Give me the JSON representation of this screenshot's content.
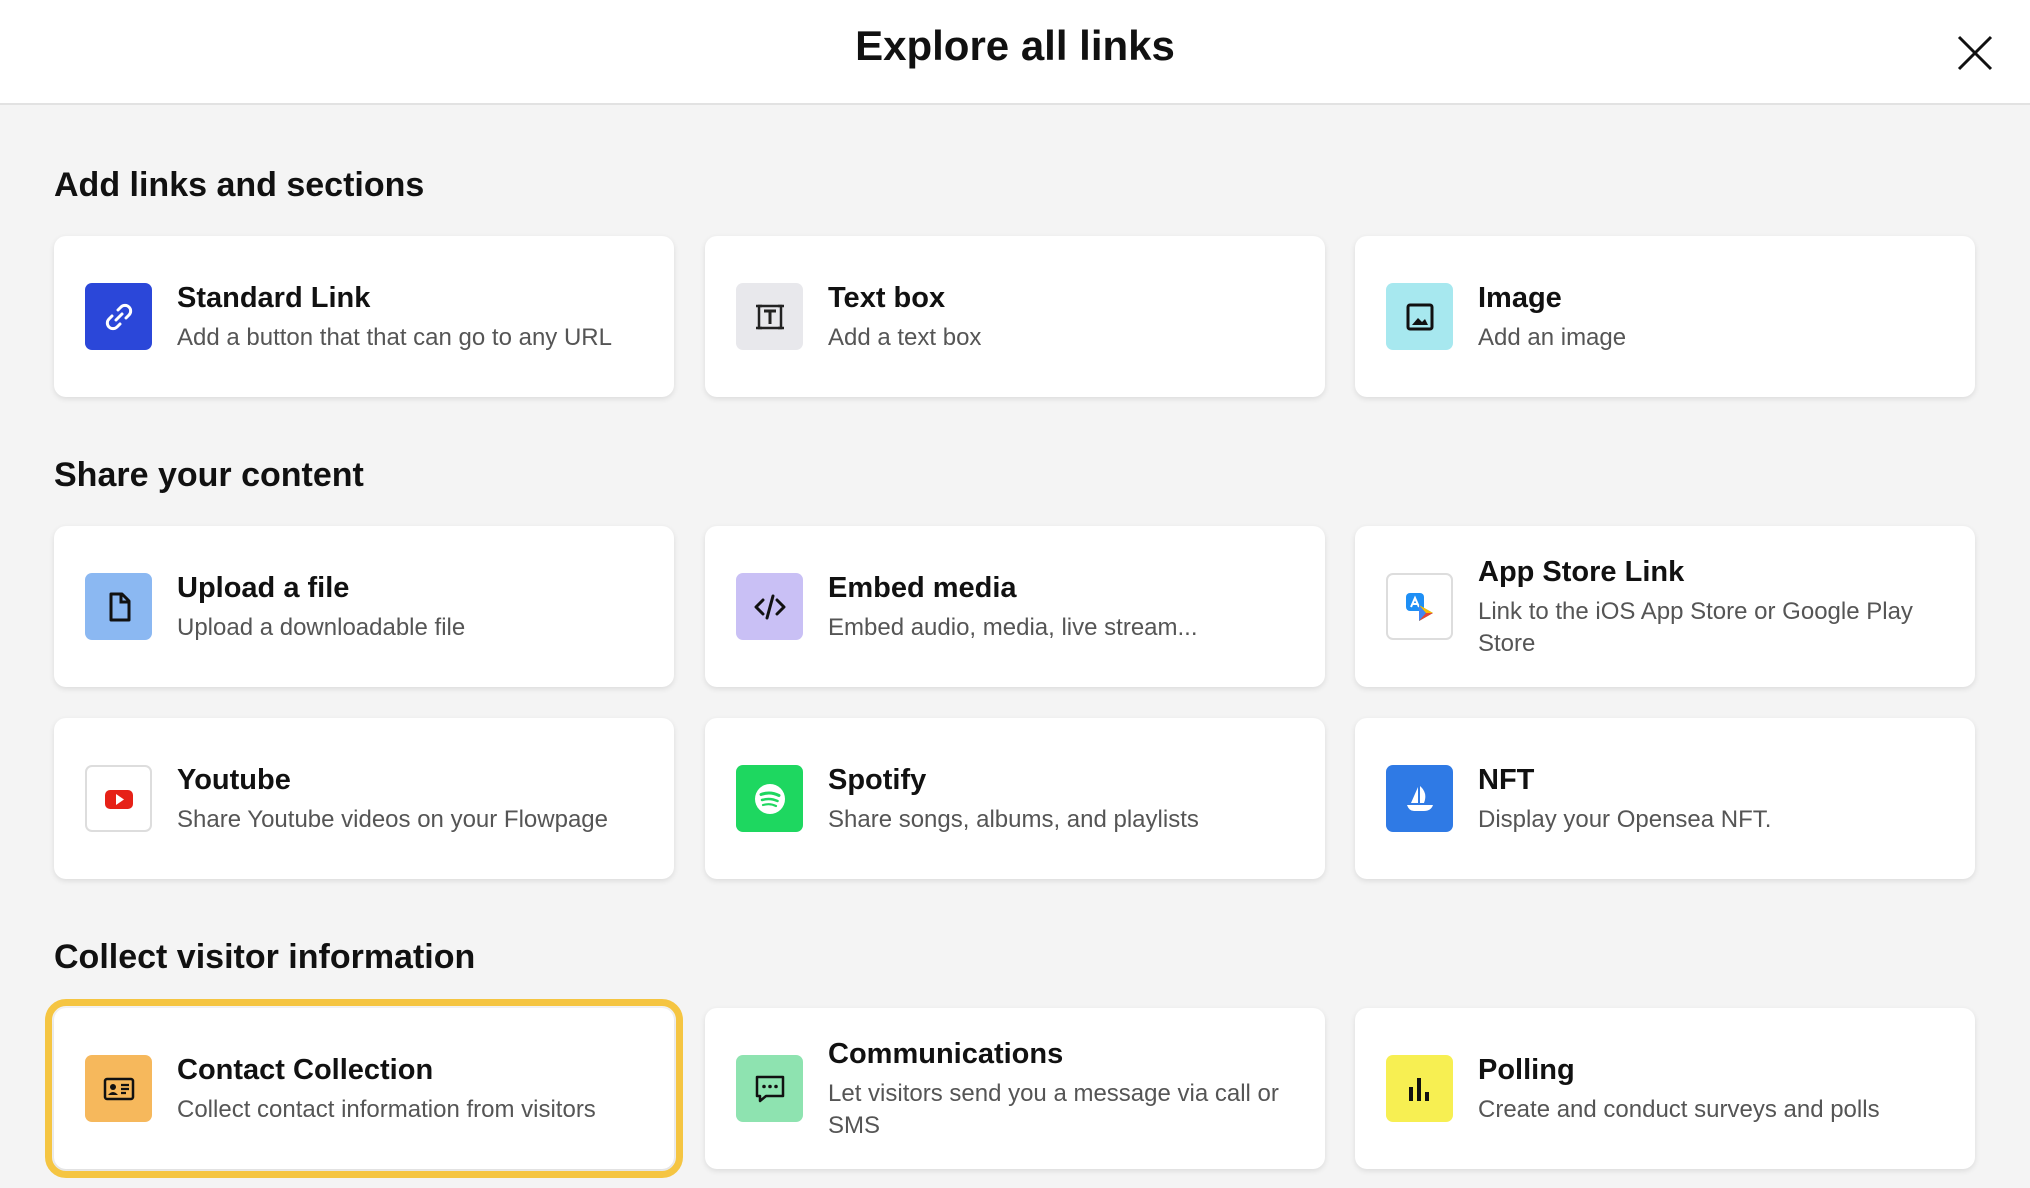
{
  "header": {
    "title": "Explore all links"
  },
  "sections": [
    {
      "title": "Add links and sections",
      "items": [
        {
          "title": "Standard Link",
          "desc": "Add a button that that can go to any URL",
          "icon": "link-icon",
          "color": "#2b47d9"
        },
        {
          "title": "Text box",
          "desc": "Add a text box",
          "icon": "text-box-icon",
          "color": "#e8e8ec"
        },
        {
          "title": "Image",
          "desc": "Add an image",
          "icon": "image-icon",
          "color": "#a7e8ef"
        }
      ]
    },
    {
      "title": "Share your content",
      "items": [
        {
          "title": "Upload a file",
          "desc": "Upload a downloadable file",
          "icon": "file-icon",
          "color": "#8bb8f2"
        },
        {
          "title": "Embed media",
          "desc": "Embed audio, media, live stream...",
          "icon": "code-icon",
          "color": "#c9c0f5"
        },
        {
          "title": "App Store Link",
          "desc": "Link to the iOS App Store or Google Play Store",
          "icon": "app-store-icon",
          "color": "#ffffff"
        },
        {
          "title": "Youtube",
          "desc": "Share Youtube videos on your Flowpage",
          "icon": "youtube-icon",
          "color": "#ffffff"
        },
        {
          "title": "Spotify",
          "desc": "Share songs, albums, and playlists",
          "icon": "spotify-icon",
          "color": "#1ed760"
        },
        {
          "title": "NFT",
          "desc": "Display your Opensea NFT.",
          "icon": "opensea-icon",
          "color": "#2f7ae5"
        }
      ]
    },
    {
      "title": "Collect visitor information",
      "items": [
        {
          "title": "Contact Collection",
          "desc": "Collect contact information from visitors",
          "icon": "contact-card-icon",
          "color": "#f6b85c",
          "highlighted": true
        },
        {
          "title": "Communications",
          "desc": "Let visitors send you a message via call or SMS",
          "icon": "message-icon",
          "color": "#8ee3b0"
        },
        {
          "title": "Polling",
          "desc": "Create and conduct surveys and polls",
          "icon": "bar-chart-icon",
          "color": "#f7ef52"
        }
      ]
    }
  ],
  "colors": {
    "highlight": "#f5c542",
    "background": "#f4f4f4"
  }
}
